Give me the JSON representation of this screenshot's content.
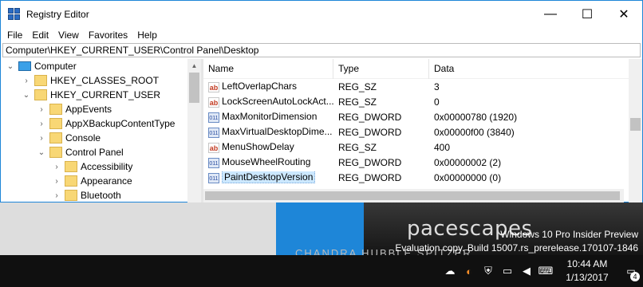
{
  "window": {
    "title": "Registry Editor",
    "minimize": "—",
    "maximize": "☐",
    "close": "✕"
  },
  "menu": [
    "File",
    "Edit",
    "View",
    "Favorites",
    "Help"
  ],
  "address": "Computer\\HKEY_CURRENT_USER\\Control Panel\\Desktop",
  "tree": [
    {
      "label": "Computer",
      "expander": "⌄",
      "icon": "computer-icon"
    },
    {
      "label": "HKEY_CLASSES_ROOT",
      "expander": "›",
      "icon": "folder-icon"
    },
    {
      "label": "HKEY_CURRENT_USER",
      "expander": "⌄",
      "icon": "folder-icon"
    },
    {
      "label": "AppEvents",
      "expander": "›",
      "icon": "folder-icon"
    },
    {
      "label": "AppXBackupContentType",
      "expander": "›",
      "icon": "folder-icon"
    },
    {
      "label": "Console",
      "expander": "›",
      "icon": "folder-icon"
    },
    {
      "label": "Control Panel",
      "expander": "⌄",
      "icon": "folder-icon"
    },
    {
      "label": "Accessibility",
      "expander": "›",
      "icon": "folder-icon"
    },
    {
      "label": "Appearance",
      "expander": "›",
      "icon": "folder-icon"
    },
    {
      "label": "Bluetooth",
      "expander": "›",
      "icon": "folder-icon"
    }
  ],
  "list": {
    "headers": {
      "name": "Name",
      "type": "Type",
      "data": "Data"
    },
    "rows": [
      {
        "name": "LeftOverlapChars",
        "type": "REG_SZ",
        "data": "3",
        "icon": "ab",
        "kind": "sz"
      },
      {
        "name": "LockScreenAutoLockAct...",
        "type": "REG_SZ",
        "data": "0",
        "icon": "ab",
        "kind": "sz"
      },
      {
        "name": "MaxMonitorDimension",
        "type": "REG_DWORD",
        "data": "0x00000780 (1920)",
        "icon": "011",
        "kind": "dword"
      },
      {
        "name": "MaxVirtualDesktopDime...",
        "type": "REG_DWORD",
        "data": "0x00000f00 (3840)",
        "icon": "011",
        "kind": "dword"
      },
      {
        "name": "MenuShowDelay",
        "type": "REG_SZ",
        "data": "400",
        "icon": "ab",
        "kind": "sz"
      },
      {
        "name": "MouseWheelRouting",
        "type": "REG_DWORD",
        "data": "0x00000002 (2)",
        "icon": "011",
        "kind": "dword"
      },
      {
        "name": "PaintDesktopVersion",
        "type": "REG_DWORD",
        "data": "0x00000000 (0)",
        "icon": "011",
        "kind": "dword",
        "selected": true
      }
    ]
  },
  "desktop": {
    "wallpaper_title": "pacescapes",
    "wallpaper_sub": "CHANDRA  HUBBLE  SPITZER",
    "watermark_line1": "Windows 10 Pro Insider Preview",
    "watermark_line2": "Evaluation copy. Build 15007.rs_prerelease.170107-1846"
  },
  "taskbar": {
    "time": "10:44 AM",
    "date": "1/13/2017",
    "notification_count": "4",
    "tray_icons": [
      "onedrive-icon",
      "app-icon",
      "defender-icon",
      "network-icon",
      "volume-icon",
      "keyboard-icon"
    ]
  }
}
